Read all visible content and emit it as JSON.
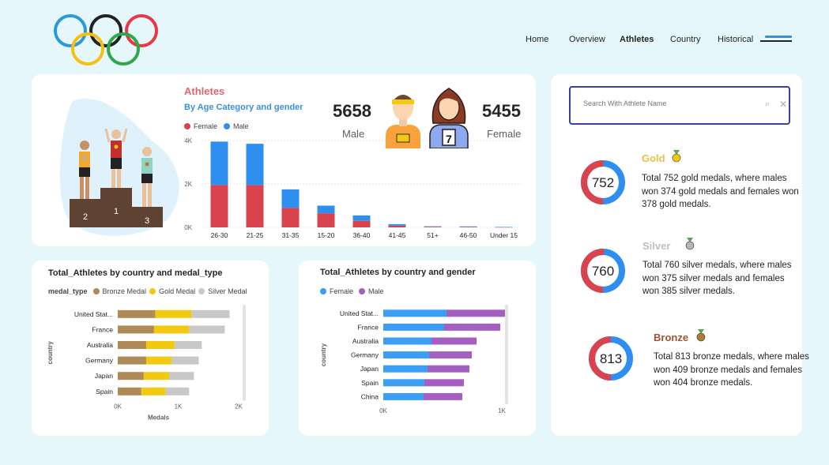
{
  "nav": {
    "items": [
      "Home",
      "Overview",
      "Athletes",
      "Country",
      "Historical"
    ],
    "active": "Athletes"
  },
  "athletes_card": {
    "title": "Athletes",
    "subtitle": "By Age Category and gender",
    "legend": [
      "Female",
      "Male"
    ],
    "male_count": "5658",
    "male_label": "Male",
    "female_count": "5455",
    "female_label": "Female",
    "podium": [
      "2",
      "1",
      "3"
    ],
    "bib_number": "7"
  },
  "search": {
    "placeholder": "Search With Athlete Name"
  },
  "medals": [
    {
      "title": "Gold",
      "total": "752",
      "desc": "Total 752 gold medals, where males won 374 gold medals and females won 378 gold medals.",
      "color": "#e8c14a",
      "male": 374,
      "female": 378
    },
    {
      "title": "Silver",
      "total": "760",
      "desc": "Total 760 silver medals, where males won 375 silver medals and females won 385 silver medals.",
      "color": "#bfbfbf",
      "male": 375,
      "female": 385
    },
    {
      "title": "Bronze",
      "total": "813",
      "desc": "Total 813 bronze medals, where males won 409 bronze medals and females won 404 bronze medals.",
      "color": "#a0522d",
      "male": 409,
      "female": 404
    }
  ],
  "colors": {
    "female": "#d9434e",
    "male": "#2e8ff0",
    "bronze": "#ad8a56",
    "gold": "#f2c811",
    "silver": "#c8c8c8",
    "female2": "#3a9ef5",
    "male2": "#a55fbf"
  },
  "chart_data": [
    {
      "type": "bar",
      "title": "",
      "categories": [
        "26-30",
        "21-25",
        "31-35",
        "15-20",
        "36-40",
        "41-45",
        "51+",
        "46-50",
        "Under 15"
      ],
      "series": [
        {
          "name": "Female",
          "values": [
            1950,
            1950,
            900,
            650,
            300,
            80,
            30,
            25,
            10
          ]
        },
        {
          "name": "Male",
          "values": [
            2000,
            1900,
            850,
            350,
            250,
            70,
            20,
            20,
            10
          ]
        }
      ],
      "stacked": true,
      "y_ticks": [
        "0K",
        "2K",
        "4K"
      ],
      "ylim": [
        0,
        4000
      ]
    },
    {
      "type": "bar",
      "orientation": "horizontal",
      "title": "Total_Athletes by country and medal_type",
      "legend_title": "medal_type",
      "categories": [
        "United Stat...",
        "France",
        "Australia",
        "Germany",
        "Japan",
        "Spain"
      ],
      "series": [
        {
          "name": "Bronze Medal",
          "values": [
            620,
            600,
            470,
            470,
            430,
            390
          ]
        },
        {
          "name": "Gold Medal",
          "values": [
            600,
            580,
            470,
            420,
            420,
            400
          ]
        },
        {
          "name": "Silver Medal",
          "values": [
            630,
            590,
            450,
            450,
            410,
            390
          ]
        }
      ],
      "stacked": true,
      "xlabel": "Medals",
      "ylabel": "country",
      "x_ticks": [
        "0K",
        "1K",
        "2K"
      ],
      "xlim": [
        0,
        2000
      ]
    },
    {
      "type": "bar",
      "orientation": "horizontal",
      "title": "Total_Athletes by country and gender",
      "categories": [
        "United Stat...",
        "France",
        "Australia",
        "Germany",
        "Japan",
        "Spain",
        "China"
      ],
      "series": [
        {
          "name": "Female",
          "values": [
            800,
            770,
            610,
            580,
            560,
            520,
            510
          ]
        },
        {
          "name": "Male",
          "values": [
            750,
            710,
            570,
            540,
            530,
            500,
            490
          ]
        }
      ],
      "stacked": true,
      "ylabel": "country",
      "x_ticks": [
        "0K",
        "1K"
      ],
      "xlim": [
        0,
        1500
      ]
    }
  ]
}
